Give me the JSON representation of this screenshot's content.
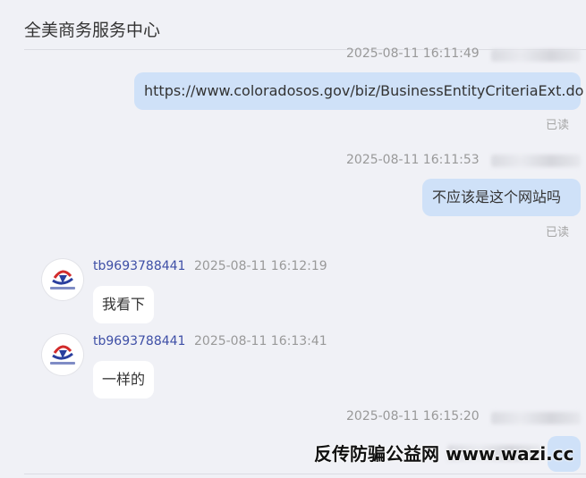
{
  "header": {
    "title": "全美商务服务中心"
  },
  "messages": [
    {
      "time": "2025-08-11 16:11:49",
      "text": "https://www.coloradosos.gov/biz/BusinessEntityCriteriaExt.do",
      "status": "已读"
    },
    {
      "time": "2025-08-11 16:11:53",
      "text": "不应该是这个网站吗",
      "status": "已读"
    },
    {
      "sender": "tb9693788441",
      "time": "2025-08-11 16:12:19",
      "text": "我看下"
    },
    {
      "sender": "tb9693788441",
      "time": "2025-08-11 16:13:41",
      "text": "一样的"
    },
    {
      "time": "2025-08-11 16:15:20",
      "text": ""
    }
  ],
  "avatar": {
    "caption": "全美商务服务中心"
  },
  "watermark": {
    "text": "反传防骗公益网 www.wazi.cc"
  },
  "colors": {
    "background": "#f0f1f6",
    "outgoing_bubble": "#cfe1f8",
    "incoming_bubble": "#ffffff",
    "sender_name": "#3e4fa6"
  }
}
